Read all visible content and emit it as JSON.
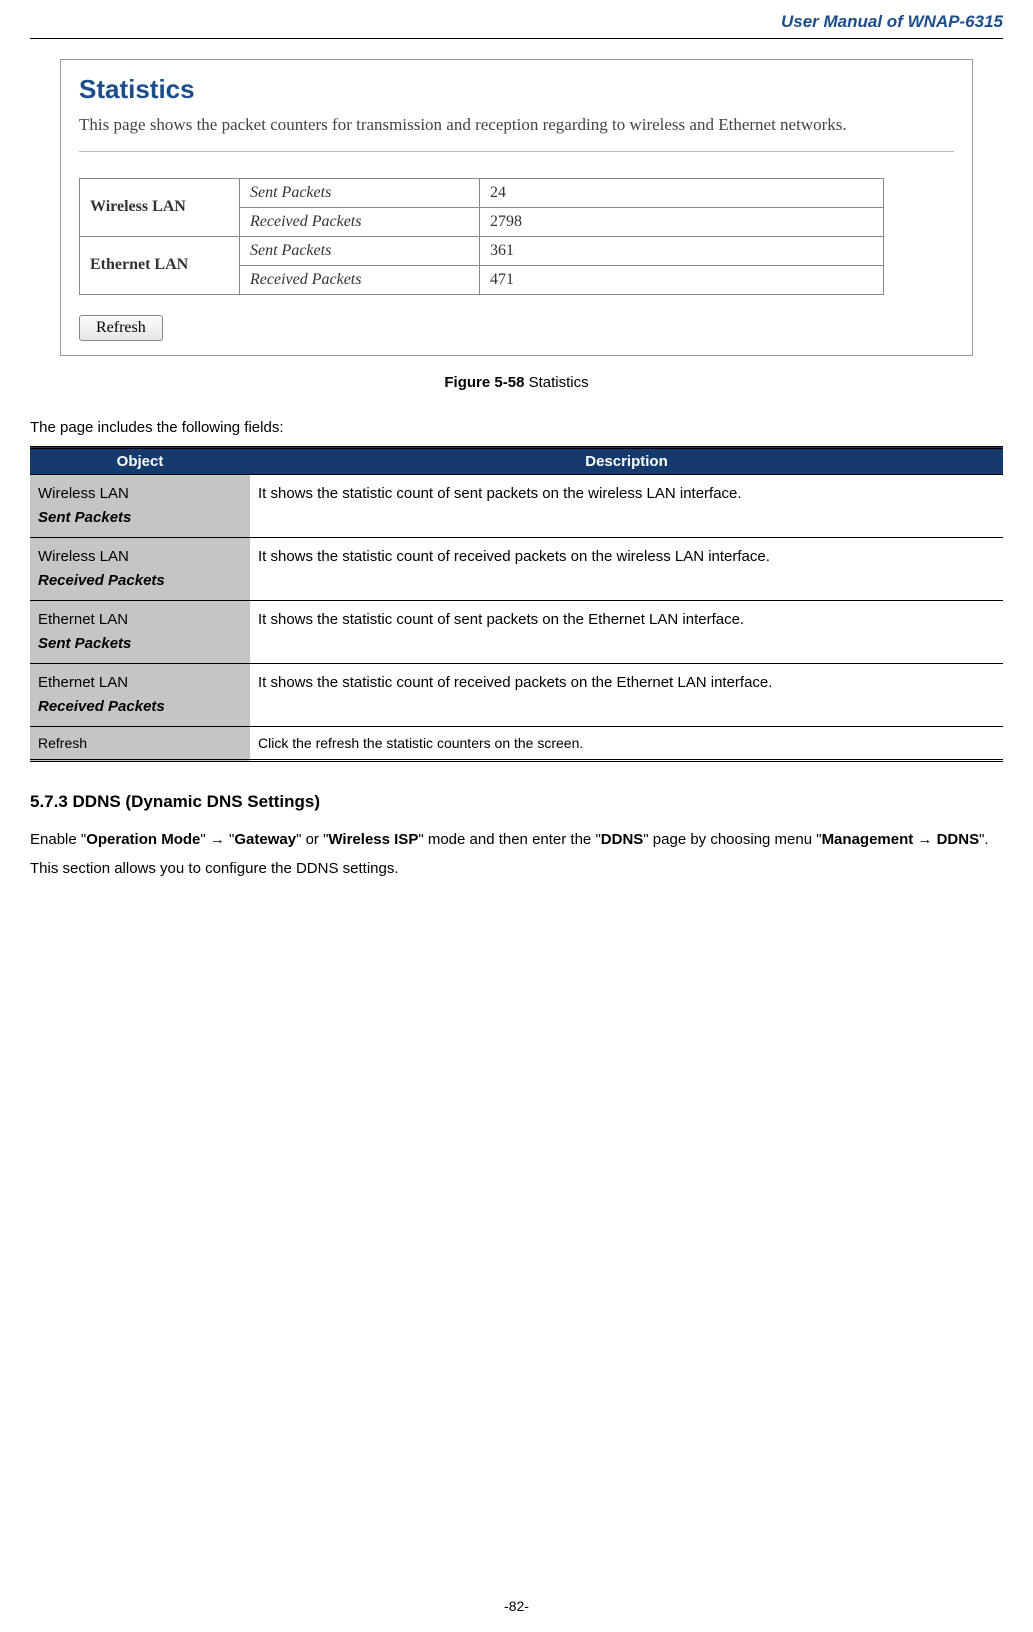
{
  "header": {
    "title": "User Manual of WNAP-6315"
  },
  "screenshot": {
    "title": "Statistics",
    "description": "This page shows the packet counters for transmission and reception regarding to wireless and Ethernet networks.",
    "iface1": "Wireless LAN",
    "iface2": "Ethernet LAN",
    "metric_sent": "Sent Packets",
    "metric_recv": "Received Packets",
    "wlan_sent": "24",
    "wlan_recv": "2798",
    "elan_sent": "361",
    "elan_recv": "471",
    "refresh_label": "Refresh"
  },
  "caption": {
    "bold": "Figure 5-58",
    "rest": " Statistics"
  },
  "intro": "The page includes the following fields:",
  "table": {
    "head_obj": "Object",
    "head_desc": "Description",
    "rows": [
      {
        "l1": "Wireless LAN",
        "l2": "Sent Packets",
        "desc": "It shows the statistic count of sent packets on the wireless LAN interface."
      },
      {
        "l1": "Wireless LAN",
        "l2": "Received Packets",
        "desc": "It shows the statistic count of received packets on the wireless LAN interface."
      },
      {
        "l1": "Ethernet LAN",
        "l2": "Sent Packets",
        "desc": "It shows the statistic count of sent packets on the Ethernet LAN interface."
      },
      {
        "l1": "Ethernet LAN",
        "l2": "Received Packets",
        "desc": "It shows the statistic count of received packets on the Ethernet LAN interface."
      }
    ],
    "refresh_obj": "Refresh",
    "refresh_desc": "Click the refresh the statistic counters on the screen."
  },
  "section": {
    "heading": "5.7.3   DDNS (Dynamic DNS Settings)",
    "p": {
      "t1": "Enable \"",
      "b1": "Operation Mode",
      "t2": "\" ",
      "arrow": "→",
      "t3": " \"",
      "b2": "Gateway",
      "t4": "\" or \"",
      "b3": "Wireless ISP",
      "t5": "\" mode and then enter the \"",
      "b4": "DDNS",
      "t6": "\" page by choosing menu \"",
      "b5": "Management → DDNS",
      "t7": "\". This section allows you to configure the DDNS settings."
    }
  },
  "footer": "-82-"
}
